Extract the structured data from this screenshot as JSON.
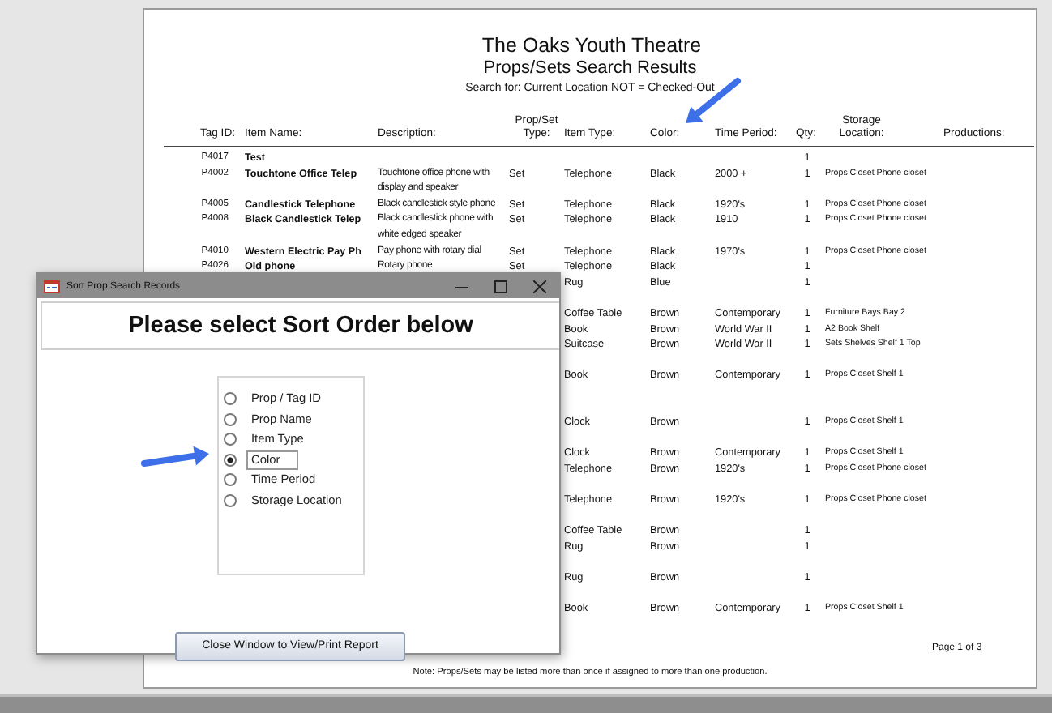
{
  "report": {
    "title": "The Oaks Youth Theatre",
    "subtitle": "Props/Sets Search Results",
    "search": "Search for: Current Location NOT = Checked-Out",
    "columns": [
      "Tag ID:",
      "Item Name:",
      "Description:",
      "Prop/Set Type:",
      "Item Type:",
      "Color:",
      "Time Period:",
      "Qty:",
      "Storage Location:",
      "Productions:"
    ],
    "rows": [
      {
        "tag_id": "P4017",
        "item_name": "Test",
        "qty": "1"
      },
      {
        "tag_id": "P4002",
        "item_name": "Touchtone Office Telep",
        "description": "Touchtone office phone with display and speaker",
        "prop_set_type": "Set",
        "item_type": "Telephone",
        "color_name": "Black",
        "time_period": "2000 +",
        "qty": "1",
        "storage_location": "Props Closet Phone closet"
      },
      {
        "tag_id": "P4005",
        "item_name": "Candlestick Telephone",
        "description": "Black candlestick style phone",
        "prop_set_type": "Set",
        "item_type": "Telephone",
        "color_name": "Black",
        "time_period": "1920's",
        "qty": "1",
        "storage_location": "Props Closet Phone closet"
      },
      {
        "tag_id": "P4008",
        "item_name": "Black Candlestick Telep",
        "description": "Black candlestick phone with white edged speaker",
        "prop_set_type": "Set",
        "item_type": "Telephone",
        "color_name": "Black",
        "time_period": "1910",
        "qty": "1",
        "storage_location": "Props Closet Phone closet"
      },
      {
        "tag_id": "P4010",
        "item_name": "Western Electric Pay Ph",
        "description": "Pay phone with rotary dial",
        "prop_set_type": "Set",
        "item_type": "Telephone",
        "color_name": "Black",
        "time_period": "1970's",
        "qty": "1",
        "storage_location": "Props Closet Phone closet"
      },
      {
        "tag_id": "P4026",
        "item_name": "Old phone",
        "description": "Rotary phone",
        "prop_set_type": "Set",
        "item_type": "Telephone",
        "color_name": "Black",
        "qty": "1"
      },
      {
        "item_type": "Rug",
        "color_name": "Blue",
        "qty": "1"
      },
      {
        "item_type": "Coffee Table",
        "color_name": "Brown",
        "time_period": "Contemporary",
        "qty": "1",
        "storage_location": "Furniture Bays Bay 2"
      },
      {
        "item_type": "Book",
        "color_name": "Brown",
        "time_period": "World War II",
        "qty": "1",
        "storage_location": "A2 Book Shelf"
      },
      {
        "item_type": "Suitcase",
        "color_name": "Brown",
        "time_period": "World War II",
        "qty": "1",
        "storage_location": "Sets Shelves Shelf 1 Top"
      },
      {
        "item_type": "Book",
        "color_name": "Brown",
        "time_period": "Contemporary",
        "qty": "1",
        "storage_location": "Props Closet Shelf 1"
      },
      {
        "item_type": "Clock",
        "color_name": "Brown",
        "qty": "1",
        "storage_location": "Props Closet Shelf 1"
      },
      {
        "item_type": "Clock",
        "color_name": "Brown",
        "time_period": "Contemporary",
        "qty": "1",
        "storage_location": "Props Closet Shelf 1"
      },
      {
        "item_type": "Telephone",
        "color_name": "Brown",
        "time_period": "1920's",
        "qty": "1",
        "storage_location": "Props Closet Phone closet"
      },
      {
        "item_type": "Telephone",
        "color_name": "Brown",
        "time_period": "1920's",
        "qty": "1",
        "storage_location": "Props Closet Phone closet"
      },
      {
        "item_type": "Coffee Table",
        "color_name": "Brown",
        "qty": "1"
      },
      {
        "item_type": "Rug",
        "color_name": "Brown",
        "qty": "1"
      },
      {
        "item_type": "Rug",
        "color_name": "Brown",
        "qty": "1"
      },
      {
        "item_type": "Book",
        "color_name": "Brown",
        "time_period": "Contemporary",
        "qty": "1",
        "storage_location": "Props Closet Shelf 1"
      }
    ],
    "page": "Page 1 of 3",
    "note": "Note:  Props/Sets may be listed more than once if assigned to more than one production."
  },
  "dialog": {
    "title": "Sort Prop Search Records",
    "heading": "Please select Sort Order below",
    "options": [
      {
        "label": "Prop / Tag ID",
        "selected": false
      },
      {
        "label": "Prop Name",
        "selected": false
      },
      {
        "label": "Item Type",
        "selected": false
      },
      {
        "label": "Color",
        "selected": true
      },
      {
        "label": "Time Period",
        "selected": false
      },
      {
        "label": "Storage Location",
        "selected": false
      }
    ],
    "button": "Close Window to View/Print Report"
  }
}
